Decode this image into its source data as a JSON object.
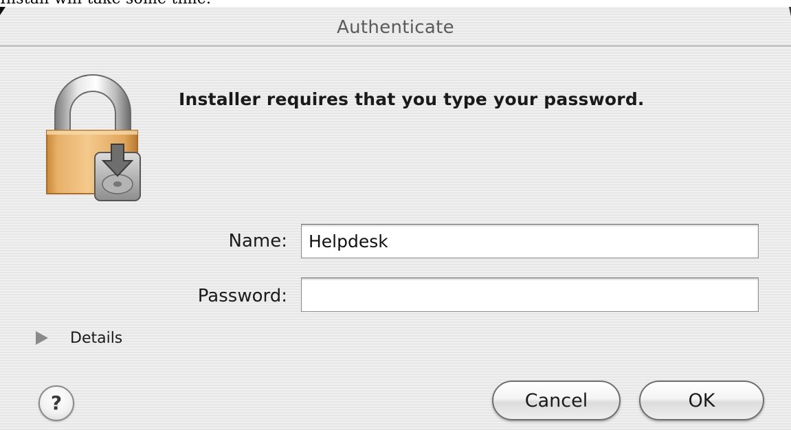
{
  "background_text": "Install will take some time.",
  "dialog": {
    "title": "Authenticate",
    "message": "Installer requires that you type your password.",
    "name_label": "Name:",
    "name_value": "Helpdesk",
    "password_label": "Password:",
    "password_value": "",
    "details_label": "Details",
    "help_glyph": "?",
    "cancel_label": "Cancel",
    "ok_label": "OK"
  },
  "icons": {
    "lock": "lock-icon",
    "disk": "disk-install-icon",
    "disclosure": "disclosure-triangle-icon",
    "help": "help-icon"
  }
}
